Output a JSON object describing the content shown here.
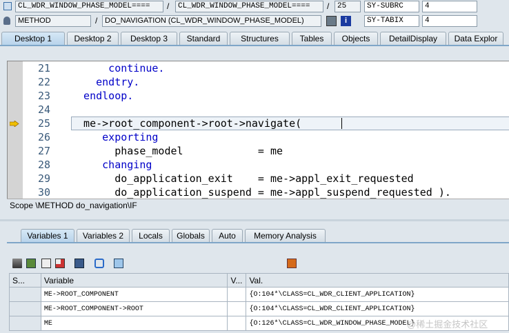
{
  "top_row1": {
    "field1": "CL_WDR_WINDOW_PHASE_MODEL====",
    "sep1": "/",
    "field2": "CL_WDR_WINDOW_PHASE_MODEL====",
    "sep2": "/",
    "line_no": "25",
    "sys_var1": "SY-SUBRC",
    "sys_val1": "4"
  },
  "top_row2": {
    "type": "METHOD",
    "sep": "/",
    "method": "DO_NAVIGATION (CL_WDR_WINDOW_PHASE_MODEL)",
    "sys_var2": "SY-TABIX",
    "sys_val2": "4"
  },
  "desktop_tabs": [
    "Desktop 1",
    "Desktop 2",
    "Desktop 3",
    "Standard",
    "Structures",
    "Tables",
    "Objects",
    "DetailDisplay",
    "Data Explor"
  ],
  "code_lines": [
    {
      "num": "21",
      "text": "      continue."
    },
    {
      "num": "22",
      "text": "    endtry."
    },
    {
      "num": "23",
      "text": "  endloop."
    },
    {
      "num": "24",
      "text": ""
    },
    {
      "num": "25",
      "text": "  me->root_component->root->navigate("
    },
    {
      "num": "26",
      "text": "     exporting"
    },
    {
      "num": "27",
      "text": "       phase_model            = me"
    },
    {
      "num": "28",
      "text": "     changing"
    },
    {
      "num": "29",
      "text": "       do_application_exit    = me->appl_exit_requested"
    },
    {
      "num": "30",
      "text": "       do_application_suspend = me->appl_suspend_requested )."
    }
  ],
  "scope": "Scope \\METHOD do_navigation\\IF",
  "var_tabs": [
    "Variables 1",
    "Variables 2",
    "Locals",
    "Globals",
    "Auto",
    "Memory Analysis"
  ],
  "table": {
    "headers": [
      "S...",
      "Variable",
      "V...",
      "Val."
    ],
    "rows": [
      {
        "variable": "ME->ROOT_COMPONENT",
        "value": "{O:104*\\CLASS=CL_WDR_CLIENT_APPLICATION}"
      },
      {
        "variable": "ME->ROOT_COMPONENT->ROOT",
        "value": "{O:104*\\CLASS=CL_WDR_CLIENT_APPLICATION}"
      },
      {
        "variable": "ME",
        "value": "{O:126*\\CLASS=CL_WDR_WINDOW_PHASE_MODEL}"
      }
    ]
  },
  "watermark": "@稀土掘金技术社区",
  "colors": {
    "keyword": "#0000c8",
    "active_tab": "#b7d2ea",
    "background": "#dfe6ec"
  }
}
